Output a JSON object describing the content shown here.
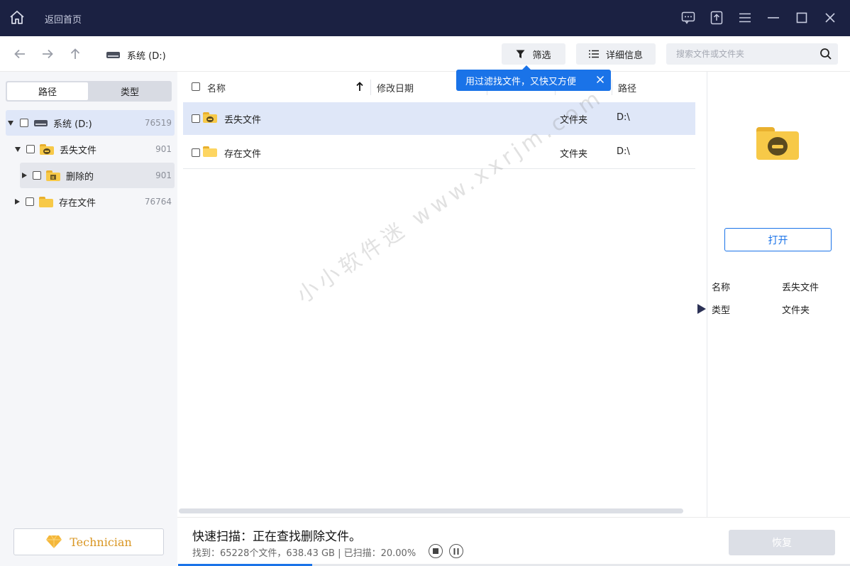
{
  "titlebar": {
    "back_home": "返回首页",
    "icons": [
      "home-icon",
      "feedback-icon",
      "upload-icon",
      "menu-icon",
      "minimize-icon",
      "maximize-icon",
      "close-icon"
    ]
  },
  "toolbar": {
    "drive_label": "系统 (D:)",
    "filter_label": "筛选",
    "detail_label": "详细信息",
    "search_placeholder": "搜索文件或文件夹"
  },
  "tooltip": {
    "text": "用过滤找文件，又快又方便"
  },
  "sidebar": {
    "tabs": [
      {
        "label": "路径",
        "active": true
      },
      {
        "label": "类型",
        "active": false
      }
    ],
    "tree": [
      {
        "label": "系统 (D:)",
        "count": "76519",
        "expanded": true,
        "selected": true
      },
      {
        "label": "丢失文件",
        "count": "901",
        "expanded": true
      },
      {
        "label": "删除的",
        "count": "901",
        "expanded": false
      },
      {
        "label": "存在文件",
        "count": "76764",
        "expanded": false
      }
    ],
    "technician_label": "Technician"
  },
  "filelist": {
    "columns": [
      "名称",
      "修改日期",
      "",
      "",
      "路径"
    ],
    "rows": [
      {
        "name": "丢失文件",
        "type": "文件夹",
        "path": "D:\\",
        "selected": true
      },
      {
        "name": "存在文件",
        "type": "文件夹",
        "path": "D:\\",
        "selected": false
      }
    ]
  },
  "watermark": "小小软件迷 www.xxrjm.com",
  "preview": {
    "open_label": "打开",
    "props": [
      {
        "label": "名称",
        "value": "丢失文件"
      },
      {
        "label": "类型",
        "value": "文件夹"
      }
    ]
  },
  "status": {
    "scan_title": "快速扫描：正在查找删除文件。",
    "stats": "找到：65228个文件，638.43 GB | 已扫描：20.00%",
    "progress": 0.2,
    "recover_label": "恢复"
  }
}
